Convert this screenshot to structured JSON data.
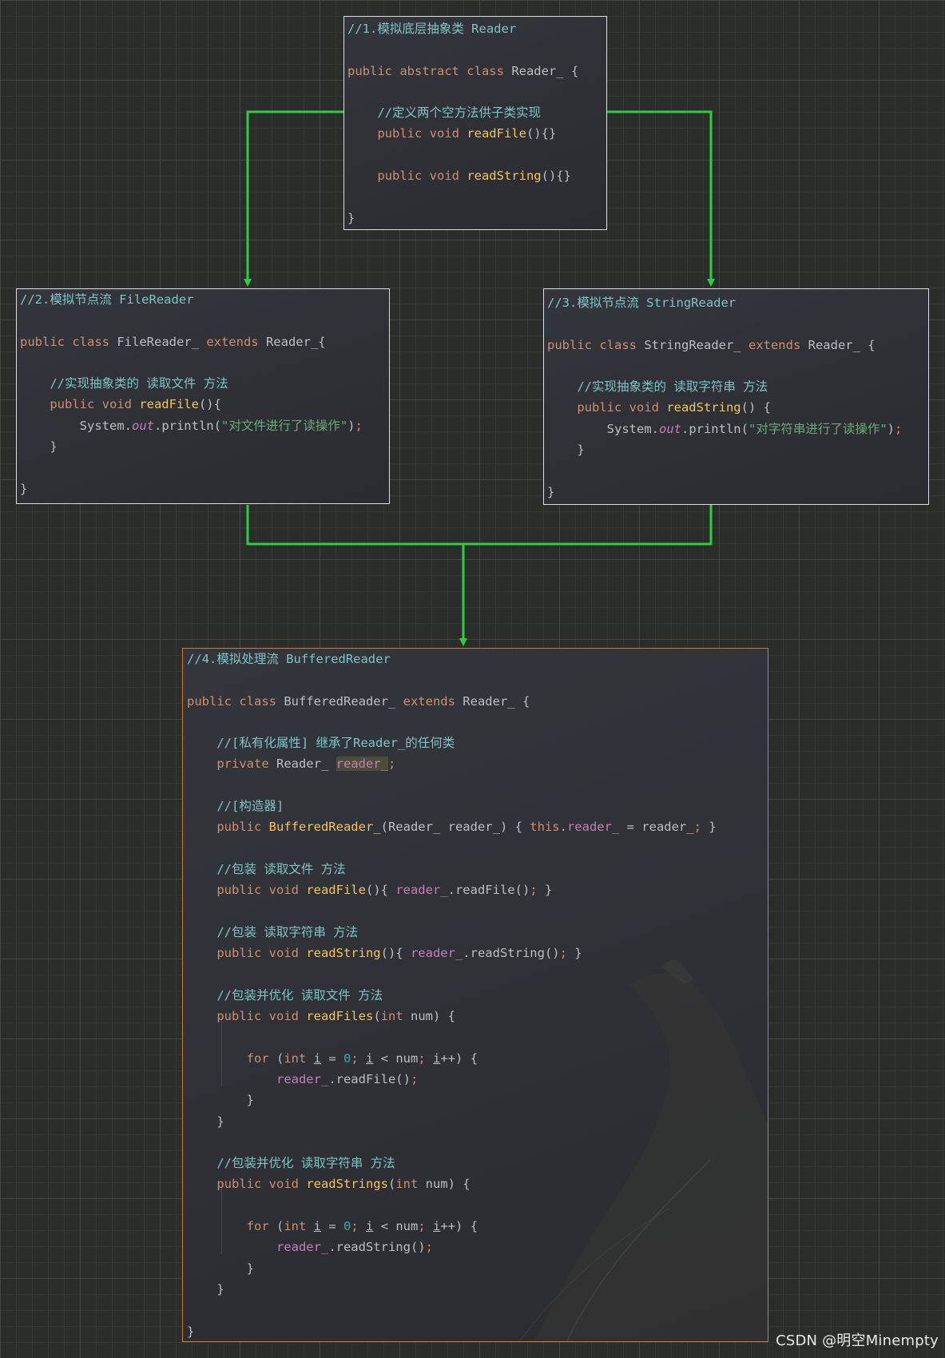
{
  "diagram": {
    "connector_color": "#2ecc40",
    "boxes": [
      {
        "id": "reader",
        "lines": [
          [
            [
              "cm",
              "//1.模拟底层抽象类 Reader"
            ]
          ],
          [],
          [
            [
              "kw",
              "public abstract class "
            ],
            [
              "pl",
              "Reader_ {"
            ]
          ],
          [],
          [
            [
              "pl",
              "    "
            ],
            [
              "cm",
              "//定义两个空方法供子类实现"
            ]
          ],
          [
            [
              "pl",
              "    "
            ],
            [
              "kw",
              "public void "
            ],
            [
              "fn",
              "readFile"
            ],
            [
              "pl",
              "(){}"
            ]
          ],
          [],
          [
            [
              "pl",
              "    "
            ],
            [
              "kw",
              "public void "
            ],
            [
              "fn",
              "readString"
            ],
            [
              "pl",
              "(){}"
            ]
          ],
          [],
          [
            [
              "pl",
              "}"
            ]
          ]
        ]
      },
      {
        "id": "file-reader",
        "lines": [
          [
            [
              "cm",
              "//2.模拟节点流 FileReader"
            ]
          ],
          [],
          [
            [
              "kw",
              "public class "
            ],
            [
              "pl",
              "FileReader_ "
            ],
            [
              "kw",
              "extends "
            ],
            [
              "pl",
              "Reader_{"
            ]
          ],
          [],
          [
            [
              "pl",
              "    "
            ],
            [
              "cm",
              "//实现抽象类的 读取文件 方法"
            ]
          ],
          [
            [
              "pl",
              "    "
            ],
            [
              "kw",
              "public void "
            ],
            [
              "fn",
              "readFile"
            ],
            [
              "pl",
              "(){"
            ]
          ],
          [
            [
              "pl",
              "        System."
            ],
            [
              "fi",
              "out"
            ],
            [
              "pl",
              ".println("
            ],
            [
              "st",
              "\"对文件进行了读操作\""
            ],
            [
              "pl",
              ")"
            ],
            [
              "kw",
              ";"
            ]
          ],
          [
            [
              "pl",
              "    }"
            ]
          ],
          [],
          [
            [
              "pl",
              "}"
            ]
          ]
        ]
      },
      {
        "id": "string-reader",
        "lines": [
          [
            [
              "cm",
              "//3.模拟节点流 StringReader"
            ]
          ],
          [],
          [
            [
              "kw",
              "public class "
            ],
            [
              "pl",
              "StringReader_ "
            ],
            [
              "kw",
              "extends "
            ],
            [
              "pl",
              "Reader_ {"
            ]
          ],
          [],
          [
            [
              "pl",
              "    "
            ],
            [
              "cm",
              "//实现抽象类的 读取字符串 方法"
            ]
          ],
          [
            [
              "pl",
              "    "
            ],
            [
              "kw",
              "public void "
            ],
            [
              "fn",
              "readString"
            ],
            [
              "pl",
              "() {"
            ]
          ],
          [
            [
              "pl",
              "        System."
            ],
            [
              "fi",
              "out"
            ],
            [
              "pl",
              ".println("
            ],
            [
              "st",
              "\"对字符串进行了读操作\""
            ],
            [
              "pl",
              ")"
            ],
            [
              "kw",
              ";"
            ]
          ],
          [
            [
              "pl",
              "    }"
            ]
          ],
          [],
          [
            [
              "pl",
              "}"
            ]
          ]
        ]
      },
      {
        "id": "buffered-reader",
        "lines": [
          [
            [
              "cm",
              "//4.模拟处理流 BufferedReader"
            ]
          ],
          [],
          [
            [
              "kw",
              "public class "
            ],
            [
              "pl",
              "BufferedReader_ "
            ],
            [
              "kw",
              "extends "
            ],
            [
              "pl",
              "Reader_ {"
            ]
          ],
          [],
          [
            [
              "pl",
              "    "
            ],
            [
              "cm",
              "//[私有化属性] 继承了Reader_的任何类"
            ]
          ],
          [
            [
              "pl",
              "    "
            ],
            [
              "kw",
              "private "
            ],
            [
              "pl",
              "Reader_ "
            ],
            [
              "hl",
              "reader_"
            ],
            [
              "kw",
              ";"
            ]
          ],
          [],
          [
            [
              "pl",
              "    "
            ],
            [
              "cm",
              "//[构造器]"
            ]
          ],
          [
            [
              "pl",
              "    "
            ],
            [
              "kw",
              "public "
            ],
            [
              "fn",
              "BufferedReader_"
            ],
            [
              "pl",
              "(Reader_ reader_) { "
            ],
            [
              "kw",
              "this"
            ],
            [
              "pl",
              "."
            ],
            [
              "fd",
              "reader_"
            ],
            [
              "pl",
              " = reader_"
            ],
            [
              "kw",
              ";"
            ],
            [
              "pl",
              " }"
            ]
          ],
          [],
          [
            [
              "pl",
              "    "
            ],
            [
              "cm",
              "//包装 读取文件 方法"
            ]
          ],
          [
            [
              "pl",
              "    "
            ],
            [
              "kw",
              "public void "
            ],
            [
              "fn",
              "readFile"
            ],
            [
              "pl",
              "(){ "
            ],
            [
              "fd",
              "reader_"
            ],
            [
              "pl",
              ".readFile()"
            ],
            [
              "kw",
              ";"
            ],
            [
              "pl",
              " }"
            ]
          ],
          [],
          [
            [
              "pl",
              "    "
            ],
            [
              "cm",
              "//包装 读取字符串 方法"
            ]
          ],
          [
            [
              "pl",
              "    "
            ],
            [
              "kw",
              "public void "
            ],
            [
              "fn",
              "readString"
            ],
            [
              "pl",
              "(){ "
            ],
            [
              "fd",
              "reader_"
            ],
            [
              "pl",
              ".readString()"
            ],
            [
              "kw",
              ";"
            ],
            [
              "pl",
              " }"
            ]
          ],
          [],
          [
            [
              "pl",
              "    "
            ],
            [
              "cm",
              "//包装并优化 读取文件 方法"
            ]
          ],
          [
            [
              "pl",
              "    "
            ],
            [
              "kw",
              "public void "
            ],
            [
              "fn",
              "readFiles"
            ],
            [
              "pl",
              "("
            ],
            [
              "kw",
              "int "
            ],
            [
              "pl",
              "num) {"
            ]
          ],
          [],
          [
            [
              "pl",
              "        "
            ],
            [
              "kw",
              "for "
            ],
            [
              "pl",
              "("
            ],
            [
              "kw",
              "int "
            ],
            [
              "ul",
              "i"
            ],
            [
              "pl",
              " = "
            ],
            [
              "nu",
              "0"
            ],
            [
              "kw",
              "; "
            ],
            [
              "ul",
              "i"
            ],
            [
              "pl",
              " < num"
            ],
            [
              "kw",
              "; "
            ],
            [
              "ul",
              "i"
            ],
            [
              "pl",
              "++) {"
            ]
          ],
          [
            [
              "pl",
              "            "
            ],
            [
              "fd",
              "reader_"
            ],
            [
              "pl",
              ".readFile()"
            ],
            [
              "kw",
              ";"
            ]
          ],
          [
            [
              "pl",
              "        }"
            ]
          ],
          [
            [
              "pl",
              "    }"
            ]
          ],
          [],
          [
            [
              "pl",
              "    "
            ],
            [
              "cm",
              "//包装并优化 读取字符串 方法"
            ]
          ],
          [
            [
              "pl",
              "    "
            ],
            [
              "kw",
              "public void "
            ],
            [
              "fn",
              "readStrings"
            ],
            [
              "pl",
              "("
            ],
            [
              "kw",
              "int "
            ],
            [
              "pl",
              "num) {"
            ]
          ],
          [],
          [
            [
              "pl",
              "        "
            ],
            [
              "kw",
              "for "
            ],
            [
              "pl",
              "("
            ],
            [
              "kw",
              "int "
            ],
            [
              "ul",
              "i"
            ],
            [
              "pl",
              " = "
            ],
            [
              "nu",
              "0"
            ],
            [
              "kw",
              "; "
            ],
            [
              "ul",
              "i"
            ],
            [
              "pl",
              " < num"
            ],
            [
              "kw",
              "; "
            ],
            [
              "ul",
              "i"
            ],
            [
              "pl",
              "++) {"
            ]
          ],
          [
            [
              "pl",
              "            "
            ],
            [
              "fd",
              "reader_"
            ],
            [
              "pl",
              ".readString()"
            ],
            [
              "kw",
              ";"
            ]
          ],
          [
            [
              "pl",
              "        }"
            ]
          ],
          [
            [
              "pl",
              "    }"
            ]
          ],
          [],
          [
            [
              "pl",
              "}"
            ]
          ]
        ]
      }
    ]
  },
  "watermark": "CSDN @明空Minempty"
}
